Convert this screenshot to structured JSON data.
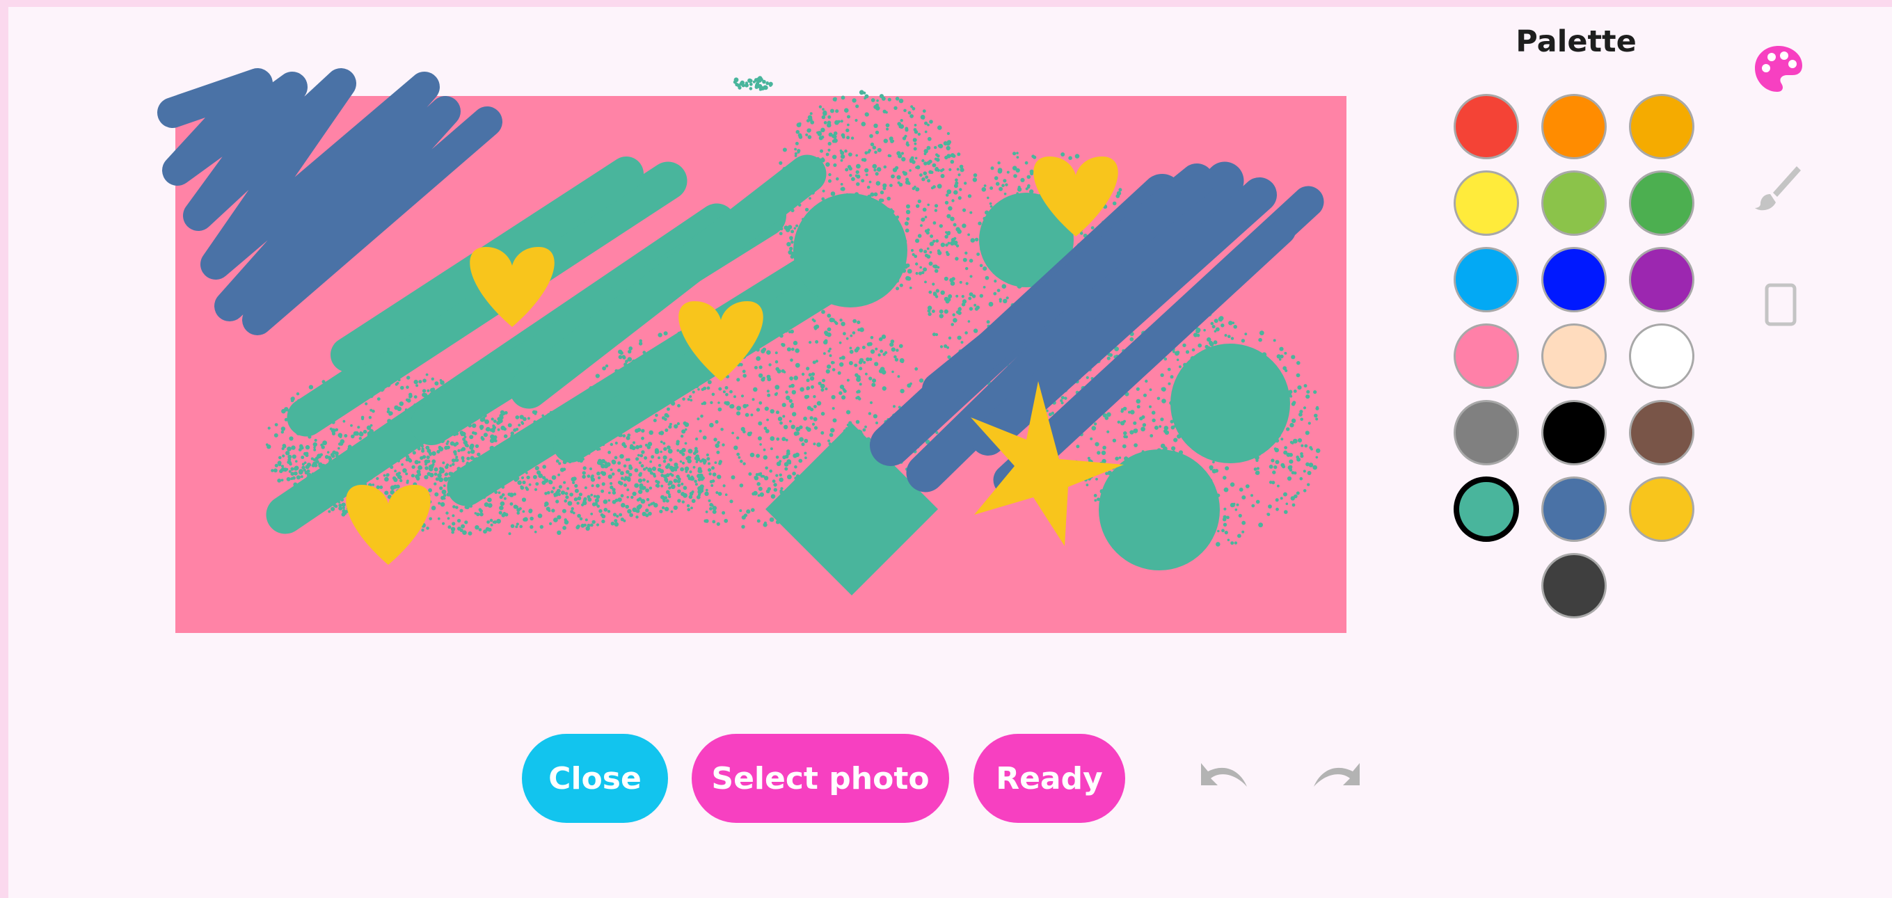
{
  "app": {
    "palette_title": "Palette"
  },
  "palette": {
    "selected_index": 15,
    "colors": [
      "#f44336",
      "#ff8c00",
      "#f5ab00",
      "#ffeb3b",
      "#8bc34a",
      "#4caf50",
      "#03a9f4",
      "#0019ff",
      "#9c27b0",
      "#ff80a8",
      "#ffdcbe",
      "#ffffff",
      "#808080",
      "#000000",
      "#795548",
      "#49b59c",
      "#4a72a6",
      "#f8c51c",
      "#3f3f3f"
    ]
  },
  "tools": [
    {
      "name": "palette-icon",
      "color": "#f740c1",
      "active": true
    },
    {
      "name": "brush-icon",
      "color": "#bdbdbd",
      "active": false
    },
    {
      "name": "eraser-icon",
      "color": "#bdbdbd",
      "active": false
    }
  ],
  "buttons": {
    "close_label": "Close",
    "select_photo_label": "Select photo",
    "ready_label": "Ready"
  },
  "history": {
    "undo_icon": "undo-icon",
    "redo_icon": "redo-icon"
  },
  "canvas": {
    "background_color": "#ff83a6",
    "teal": "#49b59c",
    "blue": "#4a72a6",
    "yellow": "#f8c51c"
  }
}
